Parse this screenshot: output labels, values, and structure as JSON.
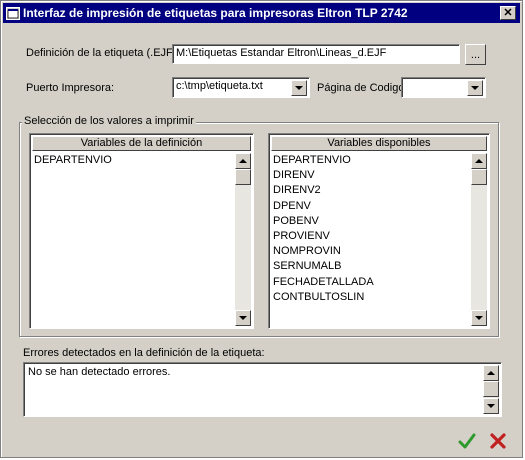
{
  "window": {
    "title": "Interfaz de impresión de etiquetas para impresoras Eltron TLP 2742"
  },
  "definition": {
    "label": "Definición de la etiqueta (.EJF)",
    "value": "M:\\Etiquetas Estandar Eltron\\Lineas_d.EJF",
    "browse_label": "..."
  },
  "port": {
    "label": "Puerto Impresora:",
    "value": "c:\\tmp\\etiqueta.txt"
  },
  "codepage": {
    "label": "Página de Codigo:",
    "value": ""
  },
  "selection": {
    "legend": "Selección de los valores a imprimir",
    "left": {
      "header": "Variables de la definición",
      "items": [
        "DEPARTENVIO"
      ]
    },
    "right": {
      "header": "Variables disponibles",
      "items": [
        "DEPARTENVIO",
        "DIRENV",
        "DIRENV2",
        "DPENV",
        "POBENV",
        "PROVIENV",
        "NOMPROVIN",
        "SERNUMALB",
        "FECHADETALLADA",
        "CONTBULTOSLIN"
      ]
    }
  },
  "errors": {
    "label": "Errores detectados en la definición de la etiqueta:",
    "text": "No se han detectado errores."
  },
  "colors": {
    "titlebar": "#000080",
    "ok": "#2e9a2e",
    "cancel": "#c02020"
  },
  "icons": {
    "ok": "checkmark-icon",
    "cancel": "x-mark-icon"
  }
}
